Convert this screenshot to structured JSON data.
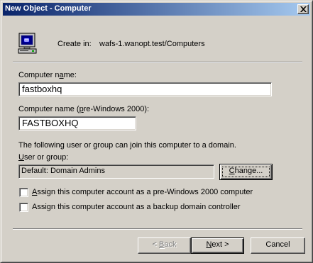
{
  "window": {
    "title": "New Object - Computer"
  },
  "header": {
    "icon": "computer-icon",
    "create_in_label": "Create in:",
    "create_in_path": "wafs-1.wanopt.test/Computers"
  },
  "form": {
    "computer_name_label_pre": "Computer n",
    "computer_name_label_u": "a",
    "computer_name_label_post": "me:",
    "computer_name_value": "fastboxhq",
    "prewin_label_pre": "Computer name (",
    "prewin_label_u": "p",
    "prewin_label_post": "re-Windows 2000):",
    "prewin_value": "FASTBOXHQ",
    "join_text": "The following user or group can join this computer to a domain.",
    "user_group_label_pre": "",
    "user_group_label_u": "U",
    "user_group_label_post": "ser or group:",
    "user_group_value": "Default: Domain Admins",
    "change_button": "Change...",
    "change_button_u": "C",
    "checkbox1_pre": "",
    "checkbox1_u": "A",
    "checkbox1_post": "ssign this computer account as a pre-Windows 2000 computer",
    "checkbox1_checked": false,
    "checkbox2_pre": "Assi",
    "checkbox2_u": "g",
    "checkbox2_post": "n this computer account as a backup domain controller",
    "checkbox2_checked": false
  },
  "footer": {
    "back_pre": "< ",
    "back_u": "B",
    "back_post": "ack",
    "next_pre": "",
    "next_u": "N",
    "next_post": "ext >",
    "cancel": "Cancel"
  }
}
